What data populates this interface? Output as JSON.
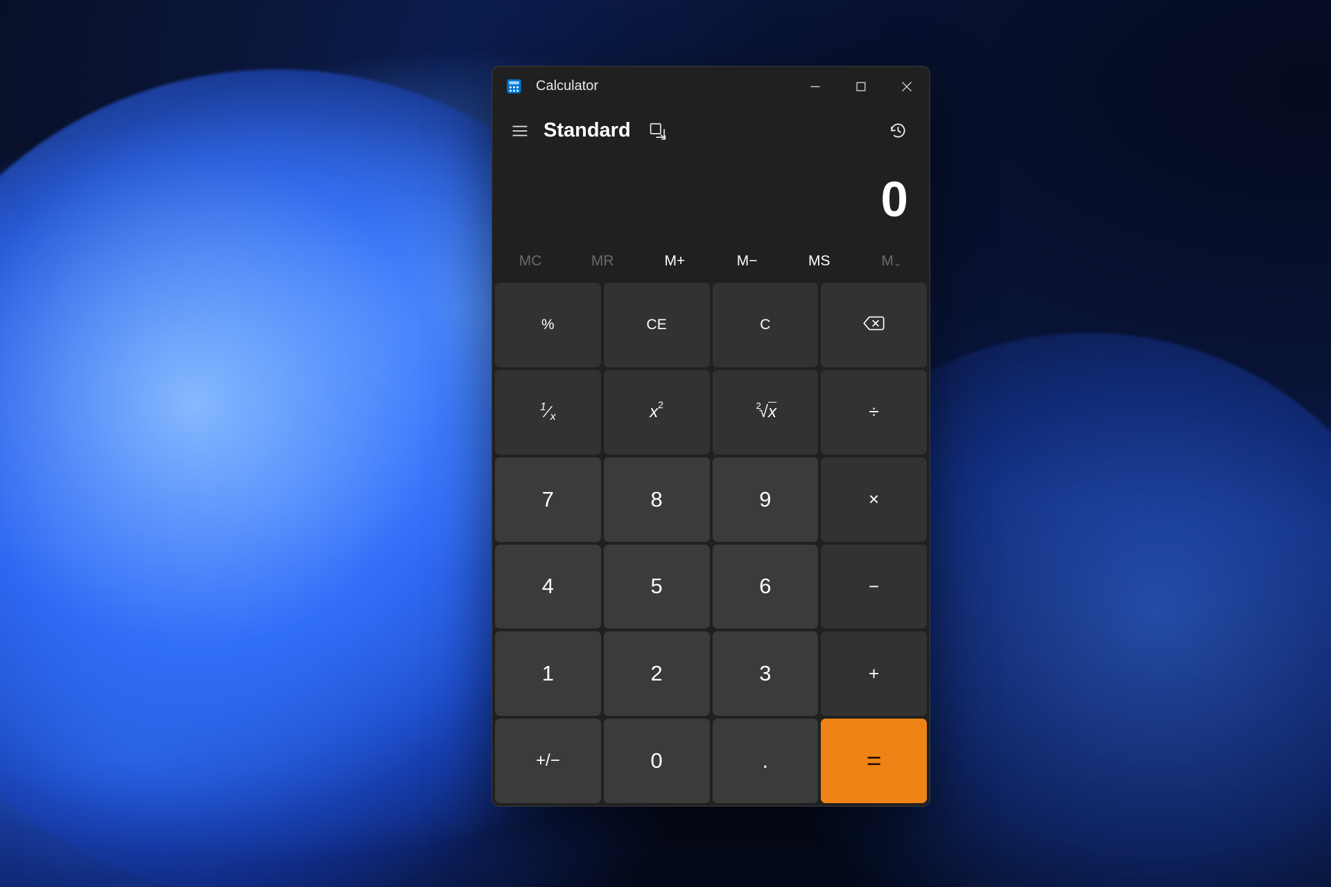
{
  "titlebar": {
    "app_name": "Calculator"
  },
  "mode": {
    "title": "Standard"
  },
  "display": {
    "value": "0"
  },
  "memory": {
    "mc": "MC",
    "mr": "MR",
    "mplus": "M+",
    "mminus": "M−",
    "ms": "MS",
    "mlist": "M"
  },
  "keys": {
    "percent": "%",
    "ce": "CE",
    "c": "C",
    "reciprocal_num": "1",
    "reciprocal_den": "x",
    "square_base": "x",
    "square_exp": "2",
    "root_deg": "2",
    "root_rad": "x",
    "divide": "÷",
    "n7": "7",
    "n8": "8",
    "n9": "9",
    "multiply": "×",
    "n4": "4",
    "n5": "5",
    "n6": "6",
    "minus": "−",
    "n1": "1",
    "n2": "2",
    "n3": "3",
    "plus": "+",
    "negate": "+/−",
    "n0": "0",
    "decimal": ".",
    "equals": "="
  },
  "colors": {
    "accent": "#f08316",
    "window_bg": "#202020",
    "key_fn": "#323232",
    "key_num": "#3b3b3b"
  }
}
